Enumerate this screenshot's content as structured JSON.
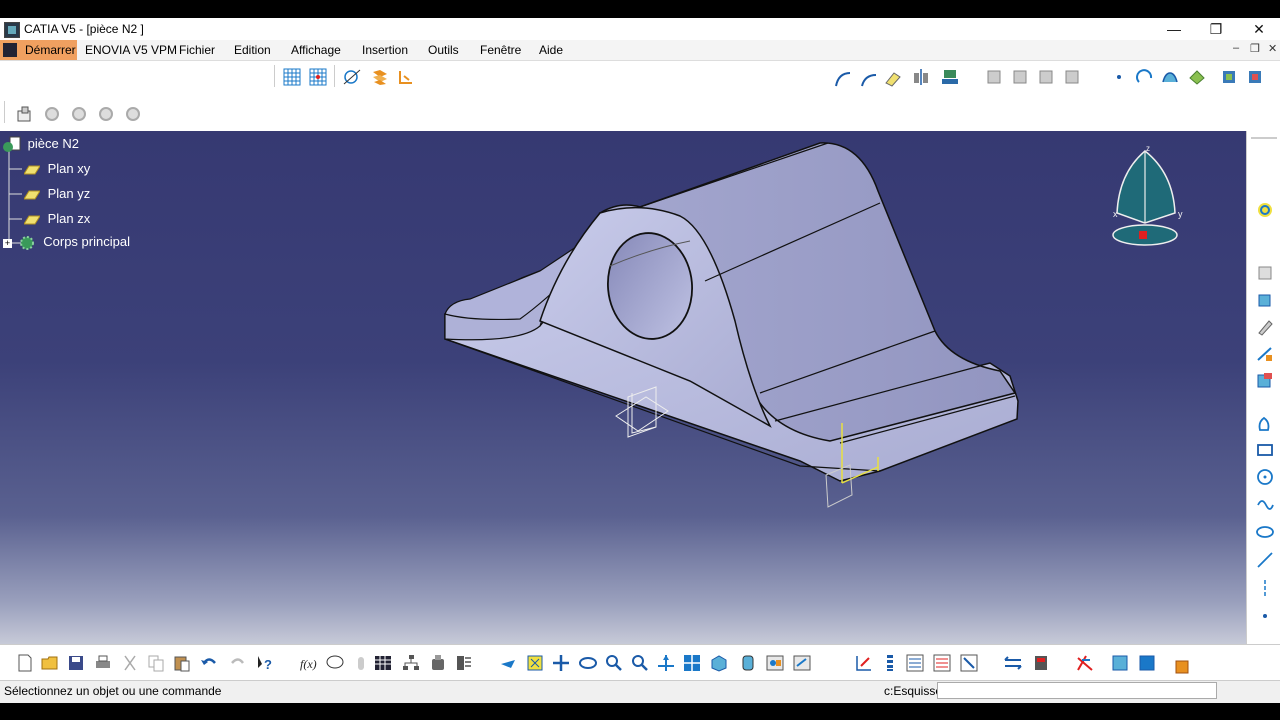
{
  "window": {
    "title": "CATIA V5 - [pièce N2 ]",
    "minimize": "—",
    "restore": "❐",
    "close": "✕"
  },
  "menu": {
    "start": "Démarrer",
    "items": [
      "ENOVIA V5 VPM",
      "Fichier",
      "Edition",
      "Affichage",
      "Insertion",
      "Outils",
      "Fenêtre",
      "Aide"
    ],
    "mdi_minimize": "–",
    "mdi_restore": "❐",
    "mdi_close": "✕"
  },
  "tree": {
    "root": "pièce N2",
    "items": [
      "Plan xy",
      "Plan yz",
      "Plan zx",
      "Corps principal"
    ]
  },
  "compass": {
    "x_label": "x",
    "y_label": "y",
    "z_label": "z"
  },
  "status": {
    "message": "Sélectionnez un objet ou une commande",
    "command_label": "c:Esquisse",
    "command_value": ""
  },
  "colors": {
    "viewport_top": "#363972",
    "viewport_bottom": "#c7cad8",
    "part_fill": "#b6b9dc",
    "accent_start_menu": "#f0a060",
    "toolbar_icon_blue": "#1a78c8",
    "toolbar_icon_orange": "#e89020"
  },
  "icons": {
    "top_toolbar": [
      "grid-icon",
      "snap-grid-icon",
      "cutting-plane-icon",
      "sketch-visualization-icon",
      "constraint-icon"
    ],
    "sketch_tools": [
      "spline-icon",
      "arc-icon",
      "eraser-icon",
      "mirror-icon",
      "stamp-icon",
      "instance-icon",
      "point-icon",
      "circle-icon",
      "sketch-icon",
      "profile-icon",
      "pad-icon",
      "pocket-icon"
    ],
    "right_toolbar": [
      "compass-icon",
      "sketch-plane-icon",
      "cube-icon",
      "pencil-icon",
      "measure-icon",
      "profile-icon",
      "pen-icon",
      "rectangle-icon",
      "circle-point-icon",
      "spline-icon",
      "ellipse-icon",
      "line-icon",
      "axis-icon",
      "point-icon"
    ],
    "bottom_toolbar": [
      "new-file-icon",
      "open-folder-icon",
      "save-icon",
      "print-icon",
      "cut-icon",
      "copy-icon",
      "paste-icon",
      "undo-icon",
      "redo-icon",
      "help-icon",
      "formula-icon",
      "comment-icon",
      "hand-icon",
      "table-icon",
      "tree-icon",
      "scan-icon",
      "knowledge-icon",
      "fly-icon",
      "fit-all-icon",
      "pan-icon",
      "rotate-icon",
      "zoom-in-icon",
      "zoom-out-icon",
      "normal-view-icon",
      "multi-view-icon",
      "iso-view-icon",
      "shading-icon",
      "hide-icon",
      "swap-visible-icon",
      "measure-between-icon",
      "measure-item-icon",
      "inertia-icon",
      "tools-palette-icon",
      "apply-material-icon",
      "catalog-icon",
      "layers-icon",
      "manipulation-icon",
      "color-icon",
      "mesh-icon",
      "analysis-icon",
      "orange-cube-icon"
    ]
  }
}
